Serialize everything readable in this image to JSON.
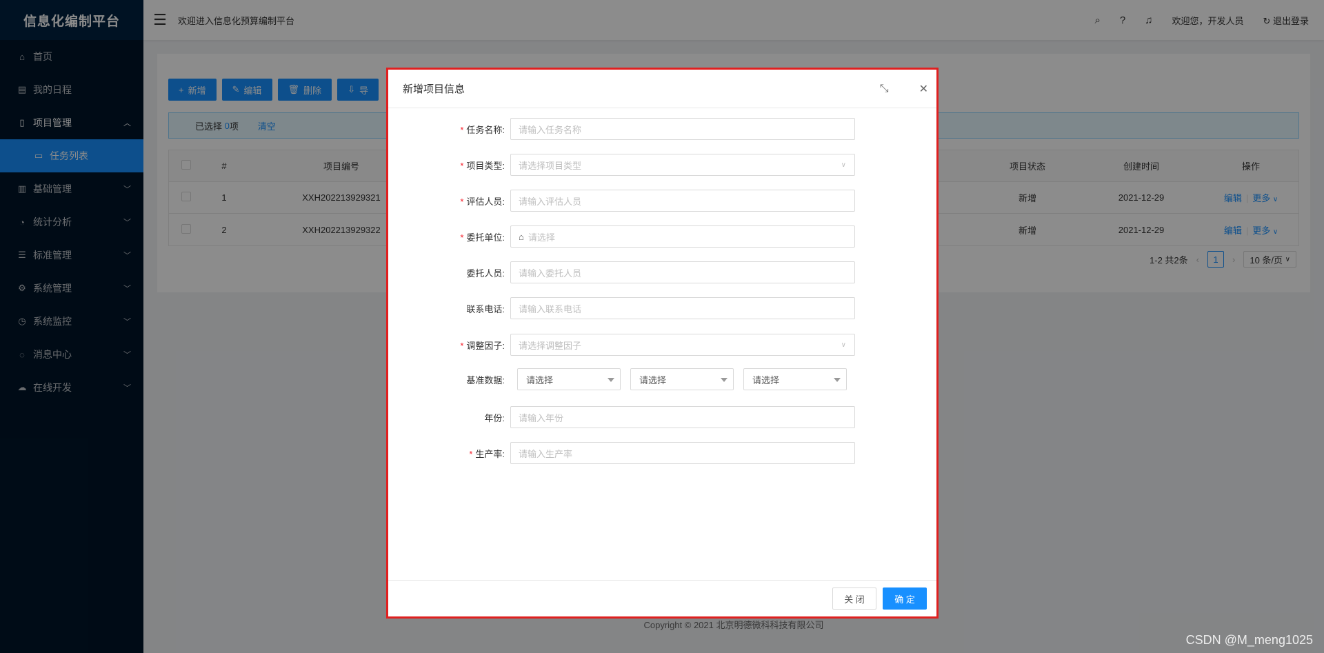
{
  "app": {
    "title": "信息化编制平台"
  },
  "sidebar": {
    "items": [
      {
        "label": "首页",
        "icon": "home-icon",
        "glyph": "⌂"
      },
      {
        "label": "我的日程",
        "icon": "calendar-icon",
        "glyph": "▤"
      },
      {
        "label": "项目管理",
        "icon": "file-icon",
        "glyph": "▯",
        "expanded": true
      },
      {
        "label": "任务列表",
        "icon": "folder-icon",
        "glyph": "▭",
        "active": true
      },
      {
        "label": "基础管理",
        "icon": "database-icon",
        "glyph": "▥"
      },
      {
        "label": "统计分析",
        "icon": "pie-chart-icon",
        "glyph": "◔"
      },
      {
        "label": "标准管理",
        "icon": "list-icon",
        "glyph": "☰"
      },
      {
        "label": "系统管理",
        "icon": "gear-icon",
        "glyph": "⚙"
      },
      {
        "label": "系统监控",
        "icon": "dashboard-icon",
        "glyph": "◷"
      },
      {
        "label": "消息中心",
        "icon": "message-icon",
        "glyph": "◌"
      },
      {
        "label": "在线开发",
        "icon": "cloud-icon",
        "glyph": "☁"
      }
    ]
  },
  "header": {
    "welcome": "欢迎进入信息化预算编制平台",
    "user_greeting": "欢迎您，开发人员",
    "logout": "退出登录"
  },
  "toolbar": {
    "add": "新增",
    "edit": "编辑",
    "delete": "删除",
    "export": "导"
  },
  "alert": {
    "prefix": "已选择 ",
    "count": "0",
    "suffix": "项",
    "clear": "清空"
  },
  "table": {
    "columns": [
      "#",
      "项目编号",
      "项目状态",
      "创建时间",
      "操作"
    ],
    "rows": [
      {
        "index": "1",
        "code": "XXH202213929321",
        "status": "新增",
        "created": "2021-12-29",
        "edit": "编辑",
        "more": "更多"
      },
      {
        "index": "2",
        "code": "XXH202213929322",
        "status": "新增",
        "created": "2021-12-29",
        "edit": "编辑",
        "more": "更多"
      }
    ]
  },
  "pagination": {
    "total": "1-2 共2条",
    "current": "1",
    "page_size": "10 条/页"
  },
  "footer": {
    "copyright": "Copyright © 2021 北京明德微科科技有限公司"
  },
  "modal": {
    "title": "新增项目信息",
    "fields": [
      {
        "label": "任务名称:",
        "required": true,
        "placeholder": "请输入任务名称",
        "type": "input"
      },
      {
        "label": "项目类型:",
        "required": true,
        "placeholder": "请选择项目类型",
        "type": "select"
      },
      {
        "label": "评估人员:",
        "required": true,
        "placeholder": "请输入评估人员",
        "type": "input"
      },
      {
        "label": "委托单位:",
        "required": true,
        "placeholder": "请选择",
        "type": "tree"
      },
      {
        "label": "委托人员:",
        "required": false,
        "placeholder": "请输入委托人员",
        "type": "input"
      },
      {
        "label": "联系电话:",
        "required": false,
        "placeholder": "请输入联系电话",
        "type": "input"
      },
      {
        "label": "调整因子:",
        "required": true,
        "placeholder": "请选择调整因子",
        "type": "select"
      },
      {
        "label": "基准数据:",
        "required": false,
        "type": "triple",
        "options": [
          "请选择",
          "请选择",
          "请选择"
        ]
      },
      {
        "label": "年份:",
        "required": false,
        "placeholder": "请输入年份",
        "type": "input"
      },
      {
        "label": "生产率:",
        "required": true,
        "placeholder": "请输入生产率",
        "type": "input"
      }
    ],
    "close_label": "关 闭",
    "ok_label": "确 定"
  },
  "watermark": "CSDN @M_meng1025",
  "colors": {
    "primary": "#1890ff",
    "sidebar": "#001529",
    "highlight_border": "#e02020",
    "required": "#f5222d"
  }
}
